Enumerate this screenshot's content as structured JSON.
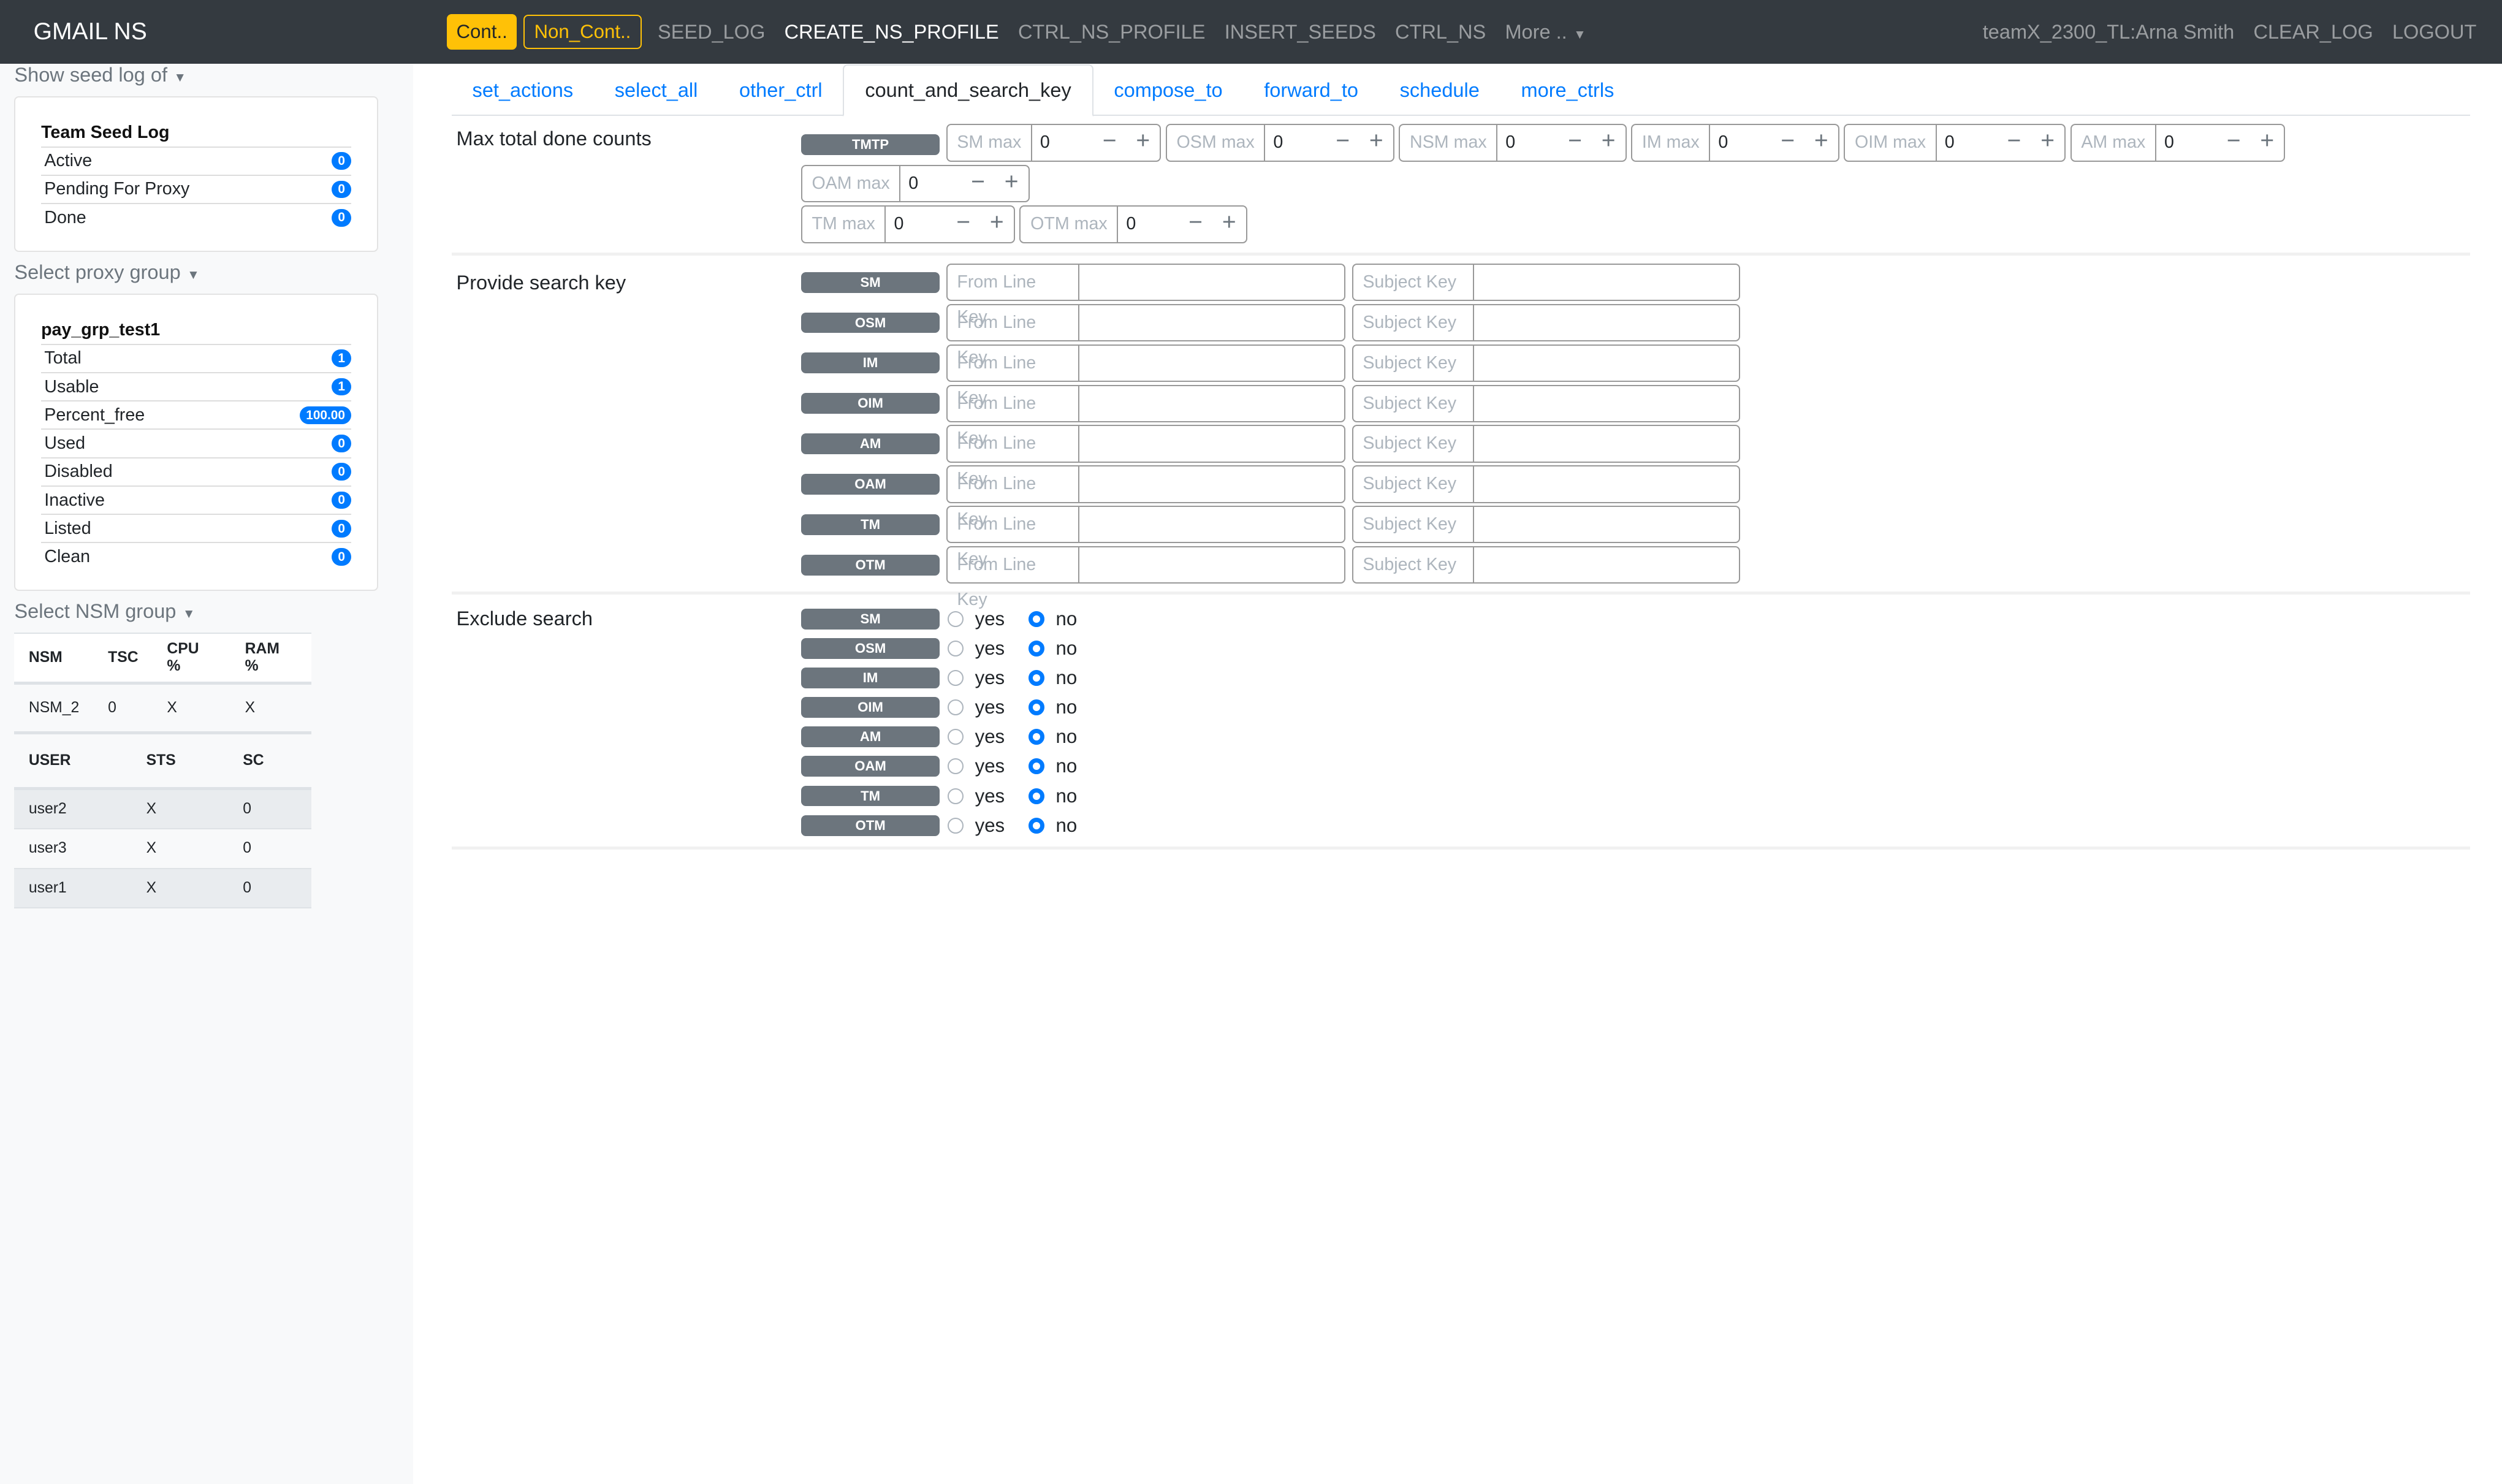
{
  "nav": {
    "brand": "GMAIL NS",
    "cont": "Cont..",
    "noncont": "Non_Cont..",
    "links": [
      "SEED_LOG",
      "CREATE_NS_PROFILE",
      "CTRL_NS_PROFILE",
      "INSERT_SEEDS",
      "CTRL_NS",
      "More .."
    ],
    "user": "teamX_2300_TL:Arna Smith",
    "clear": "CLEAR_LOG",
    "logout": "LOGOUT"
  },
  "sidebar": {
    "seed_header": "Show seed log of",
    "seed_title": "Team Seed Log",
    "seed_rows": [
      {
        "label": "Active",
        "count": "0"
      },
      {
        "label": "Pending For Proxy",
        "count": "0"
      },
      {
        "label": "Done",
        "count": "0"
      }
    ],
    "proxy_header": "Select proxy group",
    "proxy_title": "pay_grp_test1",
    "proxy_rows": [
      {
        "label": "Total",
        "count": "1"
      },
      {
        "label": "Usable",
        "count": "1"
      },
      {
        "label": "Percent_free",
        "count": "100.00"
      },
      {
        "label": "Used",
        "count": "0"
      },
      {
        "label": "Disabled",
        "count": "0"
      },
      {
        "label": "Inactive",
        "count": "0"
      },
      {
        "label": "Listed",
        "count": "0"
      },
      {
        "label": "Clean",
        "count": "0"
      }
    ],
    "nsm_header": "Select NSM group",
    "nsm_cols": [
      "NSM",
      "TSC",
      "CPU %",
      "RAM %"
    ],
    "nsm_row": [
      "NSM_2",
      "0",
      "X",
      "X"
    ],
    "user_cols": [
      "USER",
      "STS",
      "SC"
    ],
    "user_rows": [
      [
        "user2",
        "X",
        "0"
      ],
      [
        "user3",
        "X",
        "0"
      ],
      [
        "user1",
        "X",
        "0"
      ]
    ]
  },
  "tabs": [
    "set_actions",
    "select_all",
    "other_ctrl",
    "count_and_search_key",
    "compose_to",
    "forward_to",
    "schedule",
    "more_ctrls"
  ],
  "max": {
    "label": "Max total done counts",
    "tag": "TMTP",
    "fields": [
      {
        "label": "SM max",
        "value": "0"
      },
      {
        "label": "OSM max",
        "value": "0"
      },
      {
        "label": "NSM max",
        "value": "0"
      },
      {
        "label": "IM max",
        "value": "0"
      },
      {
        "label": "OIM max",
        "value": "0"
      },
      {
        "label": "AM max",
        "value": "0"
      },
      {
        "label": "OAM max",
        "value": "0"
      },
      {
        "label": "TM max",
        "value": "0"
      },
      {
        "label": "OTM max",
        "value": "0"
      }
    ]
  },
  "search": {
    "label": "Provide search key",
    "from_placeholder": "From Line Key",
    "subject_placeholder": "Subject Key",
    "types": [
      "SM",
      "OSM",
      "IM",
      "OIM",
      "AM",
      "OAM",
      "TM",
      "OTM"
    ]
  },
  "exclude": {
    "label": "Exclude search",
    "yes": "yes",
    "no": "no",
    "selected": "no"
  }
}
